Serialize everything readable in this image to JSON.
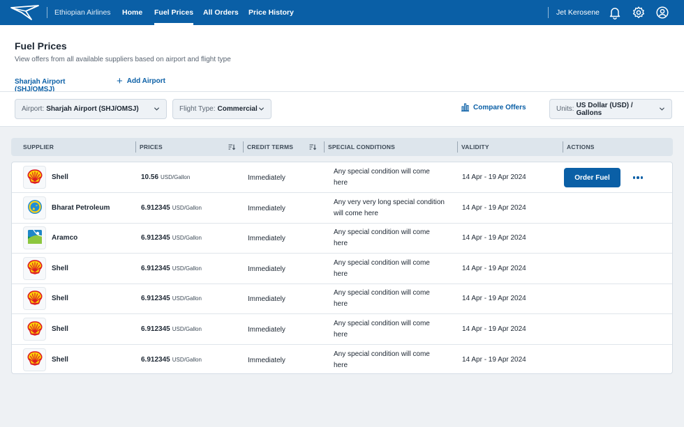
{
  "nav": {
    "brand": "Ethiopian Airlines",
    "links": [
      {
        "label": "Home",
        "active": false
      },
      {
        "label": "Fuel Prices",
        "active": true
      },
      {
        "label": "All Orders",
        "active": false
      },
      {
        "label": "Price History",
        "active": false
      }
    ],
    "product": "Jet Kerosene",
    "icons": [
      "bell-icon",
      "gear-icon",
      "user-icon"
    ]
  },
  "page": {
    "title": "Fuel Prices",
    "subtitle": "View offers from all available suppliers based on airport and flight type"
  },
  "tabs": {
    "airport": "Sharjah Airport (SHJ/OMSJ)",
    "add_label": "Add Airport"
  },
  "filters": {
    "airport_label": "Airport:",
    "airport_value": "Sharjah Airport (SHJ/OMSJ)",
    "flight_type_label": "Flight Type:",
    "flight_type_value": "Commercial",
    "compare_label": "Compare Offers",
    "units_label": "Units:",
    "units_value": "US Dollar (USD) / Gallons"
  },
  "table": {
    "columns": [
      "SUPPLIER",
      "PRICES",
      "CREDIT TERMS",
      "SPECIAL CONDITIONS",
      "VALIDITY",
      "ACTIONS"
    ],
    "order_label": "Order Fuel",
    "rows": [
      {
        "logo": "shell-logo",
        "supplier": "Shell",
        "price": "10.56",
        "unit": "USD/Gallon",
        "credit": "Immediately",
        "special": "Any special condition will come here",
        "validity": "14 Apr - 19 Apr 2024"
      },
      {
        "logo": "bharat-logo",
        "supplier": "Bharat Petroleum",
        "price": "6.912345",
        "unit": "USD/Gallon",
        "credit": "Immediately",
        "special": "Any very very long special condition will come here",
        "validity": "14 Apr - 19 Apr 2024"
      },
      {
        "logo": "aramco-logo",
        "supplier": "Aramco",
        "price": "6.912345",
        "unit": "USD/Gallon",
        "credit": "Immediately",
        "special": "Any special condition will come here",
        "validity": "14 Apr - 19 Apr 2024"
      },
      {
        "logo": "shell-logo",
        "supplier": "Shell",
        "price": "6.912345",
        "unit": "USD/Gallon",
        "credit": "Immediately",
        "special": "Any special condition will come here",
        "validity": "14 Apr - 19 Apr 2024"
      },
      {
        "logo": "shell-logo",
        "supplier": "Shell",
        "price": "6.912345",
        "unit": "USD/Gallon",
        "credit": "Immediately",
        "special": "Any special condition will come here",
        "validity": "14 Apr - 19 Apr 2024"
      },
      {
        "logo": "shell-logo",
        "supplier": "Shell",
        "price": "6.912345",
        "unit": "USD/Gallon",
        "credit": "Immediately",
        "special": "Any special condition will come here",
        "validity": "14 Apr - 19 Apr 2024"
      },
      {
        "logo": "shell-logo",
        "supplier": "Shell",
        "price": "6.912345",
        "unit": "USD/Gallon",
        "credit": "Immediately",
        "special": "Any special condition will come here",
        "validity": "14 Apr - 19 Apr 2024"
      }
    ]
  },
  "colors": {
    "primary": "#0a5fa6",
    "shell_red": "#dd1d21",
    "shell_yellow": "#fbce07"
  }
}
